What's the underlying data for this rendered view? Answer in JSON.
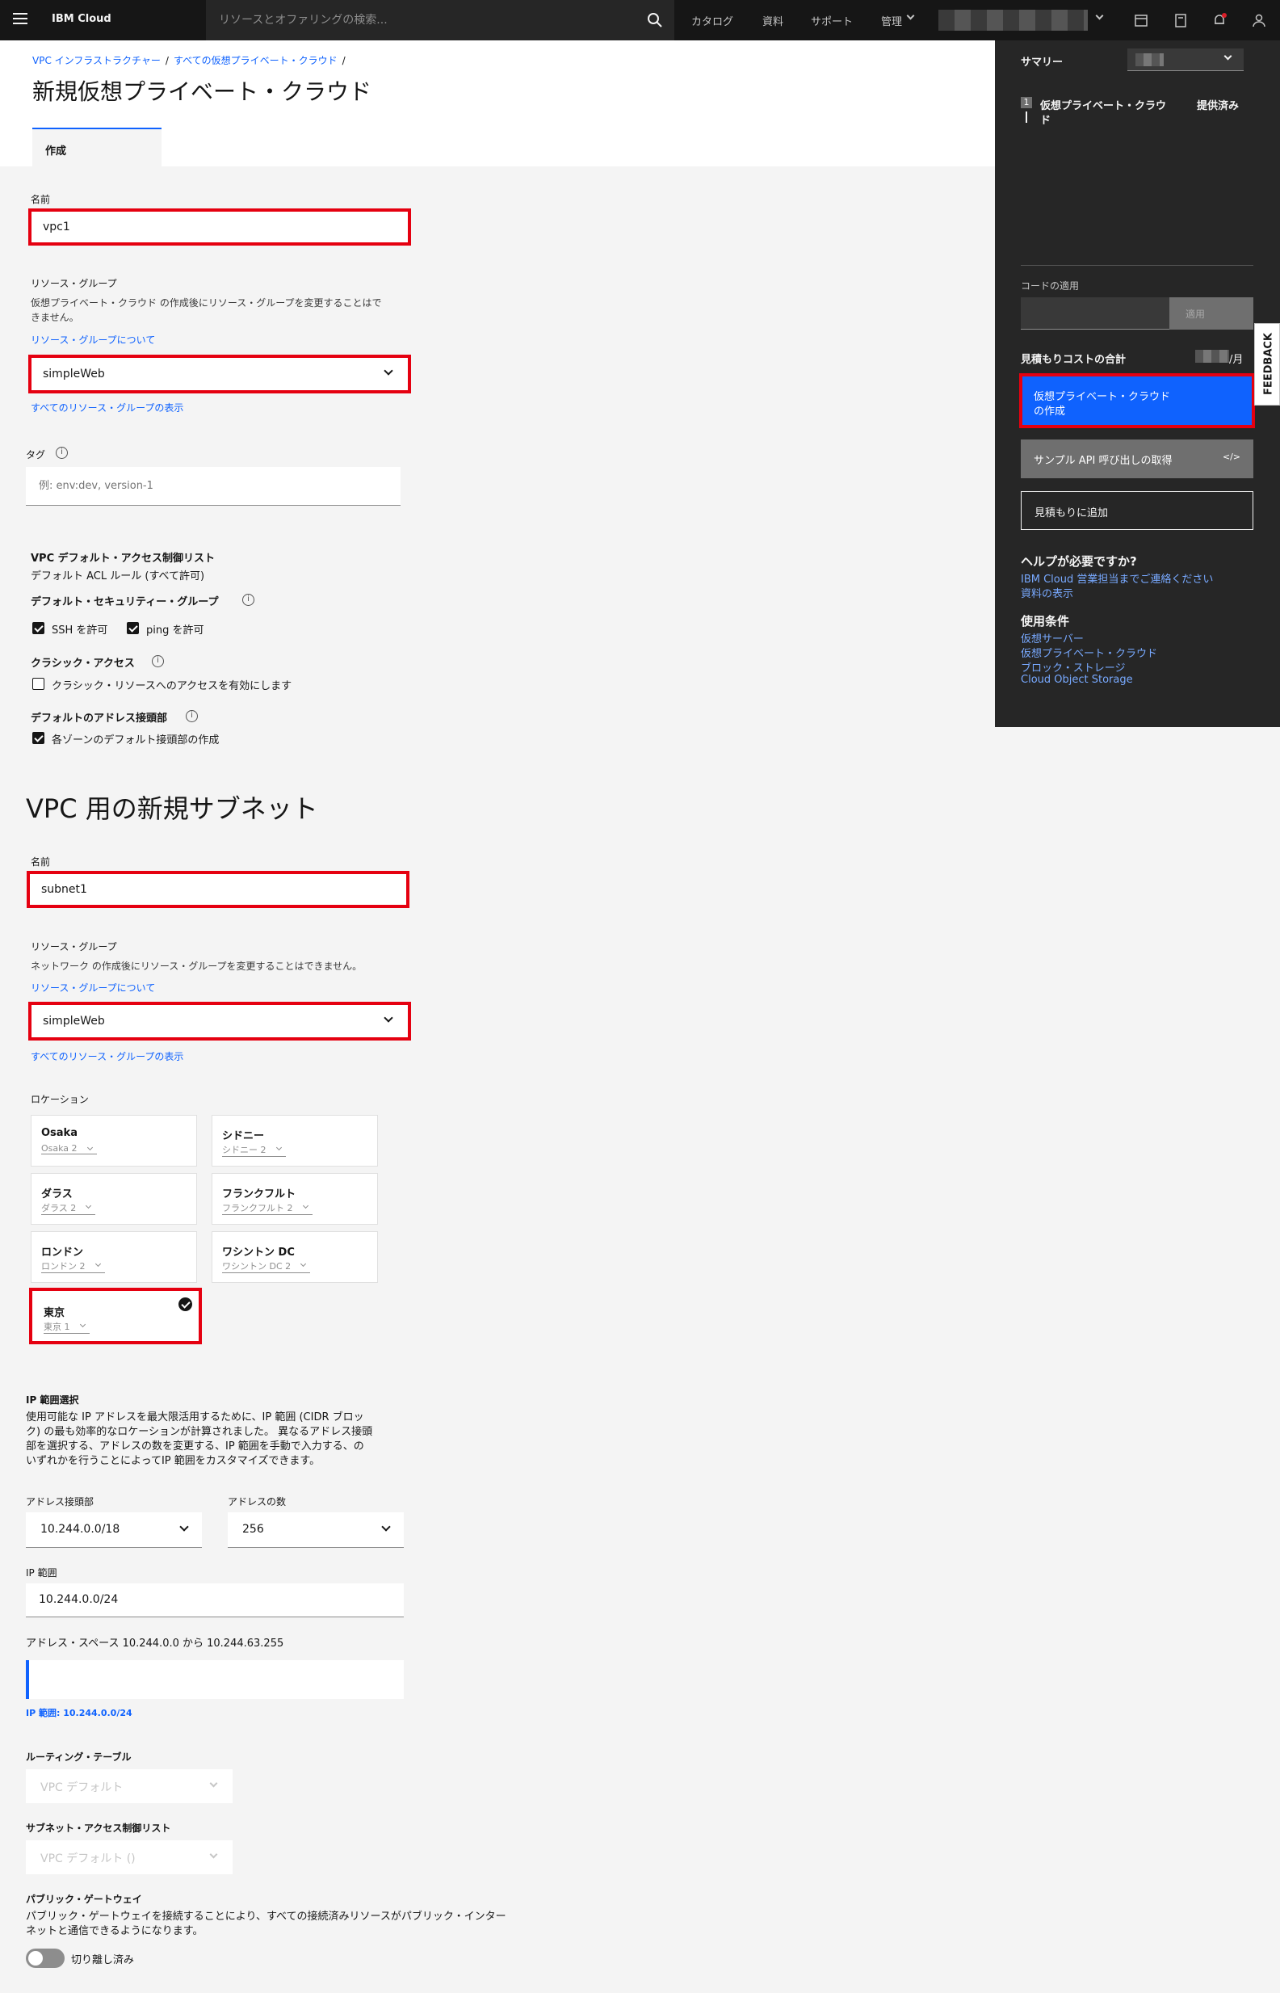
{
  "topnav": {
    "brand": "IBM Cloud",
    "search_placeholder": "リソースとオファリングの検索...",
    "links": [
      "カタログ",
      "資料",
      "サポート",
      "管理"
    ]
  },
  "breadcrumb": [
    "VPC インフラストラクチャー",
    "すべての仮想プライベート・クラウド"
  ],
  "page_title": "新規仮想プライベート・クラウド",
  "tab_create": "作成",
  "vpc": {
    "name_label": "名前",
    "name_value": "vpc1",
    "rg_label": "リソース・グループ",
    "rg_helper_1": "仮想プライベート・クラウド の作成後にリソース・グループを変更することはで",
    "rg_helper_2": "きません。",
    "rg_link": "リソース・グループについて",
    "rg_value": "simpleWeb",
    "rg_show_all": "すべてのリソース・グループの表示",
    "tag_label": "タグ",
    "tag_placeholder": "例: env:dev, version-1",
    "acl_label": "VPC デフォルト・アクセス制御リスト",
    "acl_value": "デフォルト ACL ルール (すべて許可)",
    "sg_label": "デフォルト・セキュリティー・グループ",
    "ssh_label": "SSH を許可",
    "ping_label": "ping を許可",
    "classic_label": "クラシック・アクセス",
    "classic_cb_label": "クラシック・リソースへのアクセスを有効にします",
    "prefix_label": "デフォルトのアドレス接頭部",
    "prefix_cb_label": "各ゾーンのデフォルト接頭部の作成"
  },
  "subnet": {
    "heading": "VPC 用の新規サブネット",
    "name_label": "名前",
    "name_value": "subnet1",
    "rg_label": "リソース・グループ",
    "rg_helper": "ネットワーク の作成後にリソース・グループを変更することはできません。",
    "rg_link": "リソース・グループについて",
    "rg_value": "simpleWeb",
    "rg_show_all": "すべてのリソース・グループの表示",
    "location_label": "ロケーション",
    "locations": [
      {
        "name": "Osaka",
        "zone": "Osaka 2"
      },
      {
        "name": "シドニー",
        "zone": "シドニー 2"
      },
      {
        "name": "ダラス",
        "zone": "ダラス 2"
      },
      {
        "name": "フランクフルト",
        "zone": "フランクフルト 2"
      },
      {
        "name": "ロンドン",
        "zone": "ロンドン 2"
      },
      {
        "name": "ワシントン DC",
        "zone": "ワシントン DC 2"
      },
      {
        "name": "東京",
        "zone": "東京 1"
      }
    ],
    "ip_label": "IP 範囲選択",
    "ip_helper_1": "使用可能な IP アドレスを最大限活用するために、IP 範囲 (CIDR ブロッ",
    "ip_helper_2": "ク) の最も効率的なロケーションが計算されました。 異なるアドレス接頭",
    "ip_helper_3": "部を選択する、アドレスの数を変更する、IP 範囲を手動で入力する、の",
    "ip_helper_4": "いずれかを行うことによってIP 範囲をカスタマイズできます。",
    "prefix_label": "アドレス接頭部",
    "prefix_value": "10.244.0.0/18",
    "count_label": "アドレスの数",
    "count_value": "256",
    "range_label": "IP 範囲",
    "range_value": "10.244.0.0/24",
    "space_text": "アドレス・スペース  10.244.0.0 から 10.244.63.255",
    "range_note": "IP 範囲: 10.244.0.0/24",
    "routing_label": "ルーティング・テーブル",
    "routing_value": "VPC デフォルト",
    "acl_label": "サブネット・アクセス制御リスト",
    "acl_value": "VPC デフォルト ()",
    "gw_label": "パブリック・ゲートウェイ",
    "gw_helper_1": "パブリック・ゲートウェイを接続することにより、すべての接続済みリソースがパブリック・インター",
    "gw_helper_2": "ネットと通信できるようになります。",
    "gw_toggle_label": "切り離し済み"
  },
  "sidebar": {
    "summary": "サマリー",
    "item_num": "1",
    "item_name_1": "仮想プライベート・クラウ",
    "item_name_2": "ド",
    "item_status": "提供済み",
    "code_label": "コードの適用",
    "apply_btn": "適用",
    "total_label": "見積もりコストの合計",
    "per_month": "/月",
    "create_btn_1": "仮想プライベート・クラウド",
    "create_btn_2": "の作成",
    "api_btn": "サンプル API 呼び出しの取得",
    "estimate_btn": "見積もりに追加",
    "help_title": "ヘルプが必要ですか?",
    "help_link_1": "IBM Cloud 営業担当までご連絡ください",
    "help_link_2": "資料の表示",
    "terms_title": "使用条件",
    "terms_links": [
      "仮想サーバー",
      "仮想プライベート・クラウド",
      "ブロック・ストレージ",
      "Cloud Object Storage"
    ]
  },
  "feedback": "FEEDBACK"
}
